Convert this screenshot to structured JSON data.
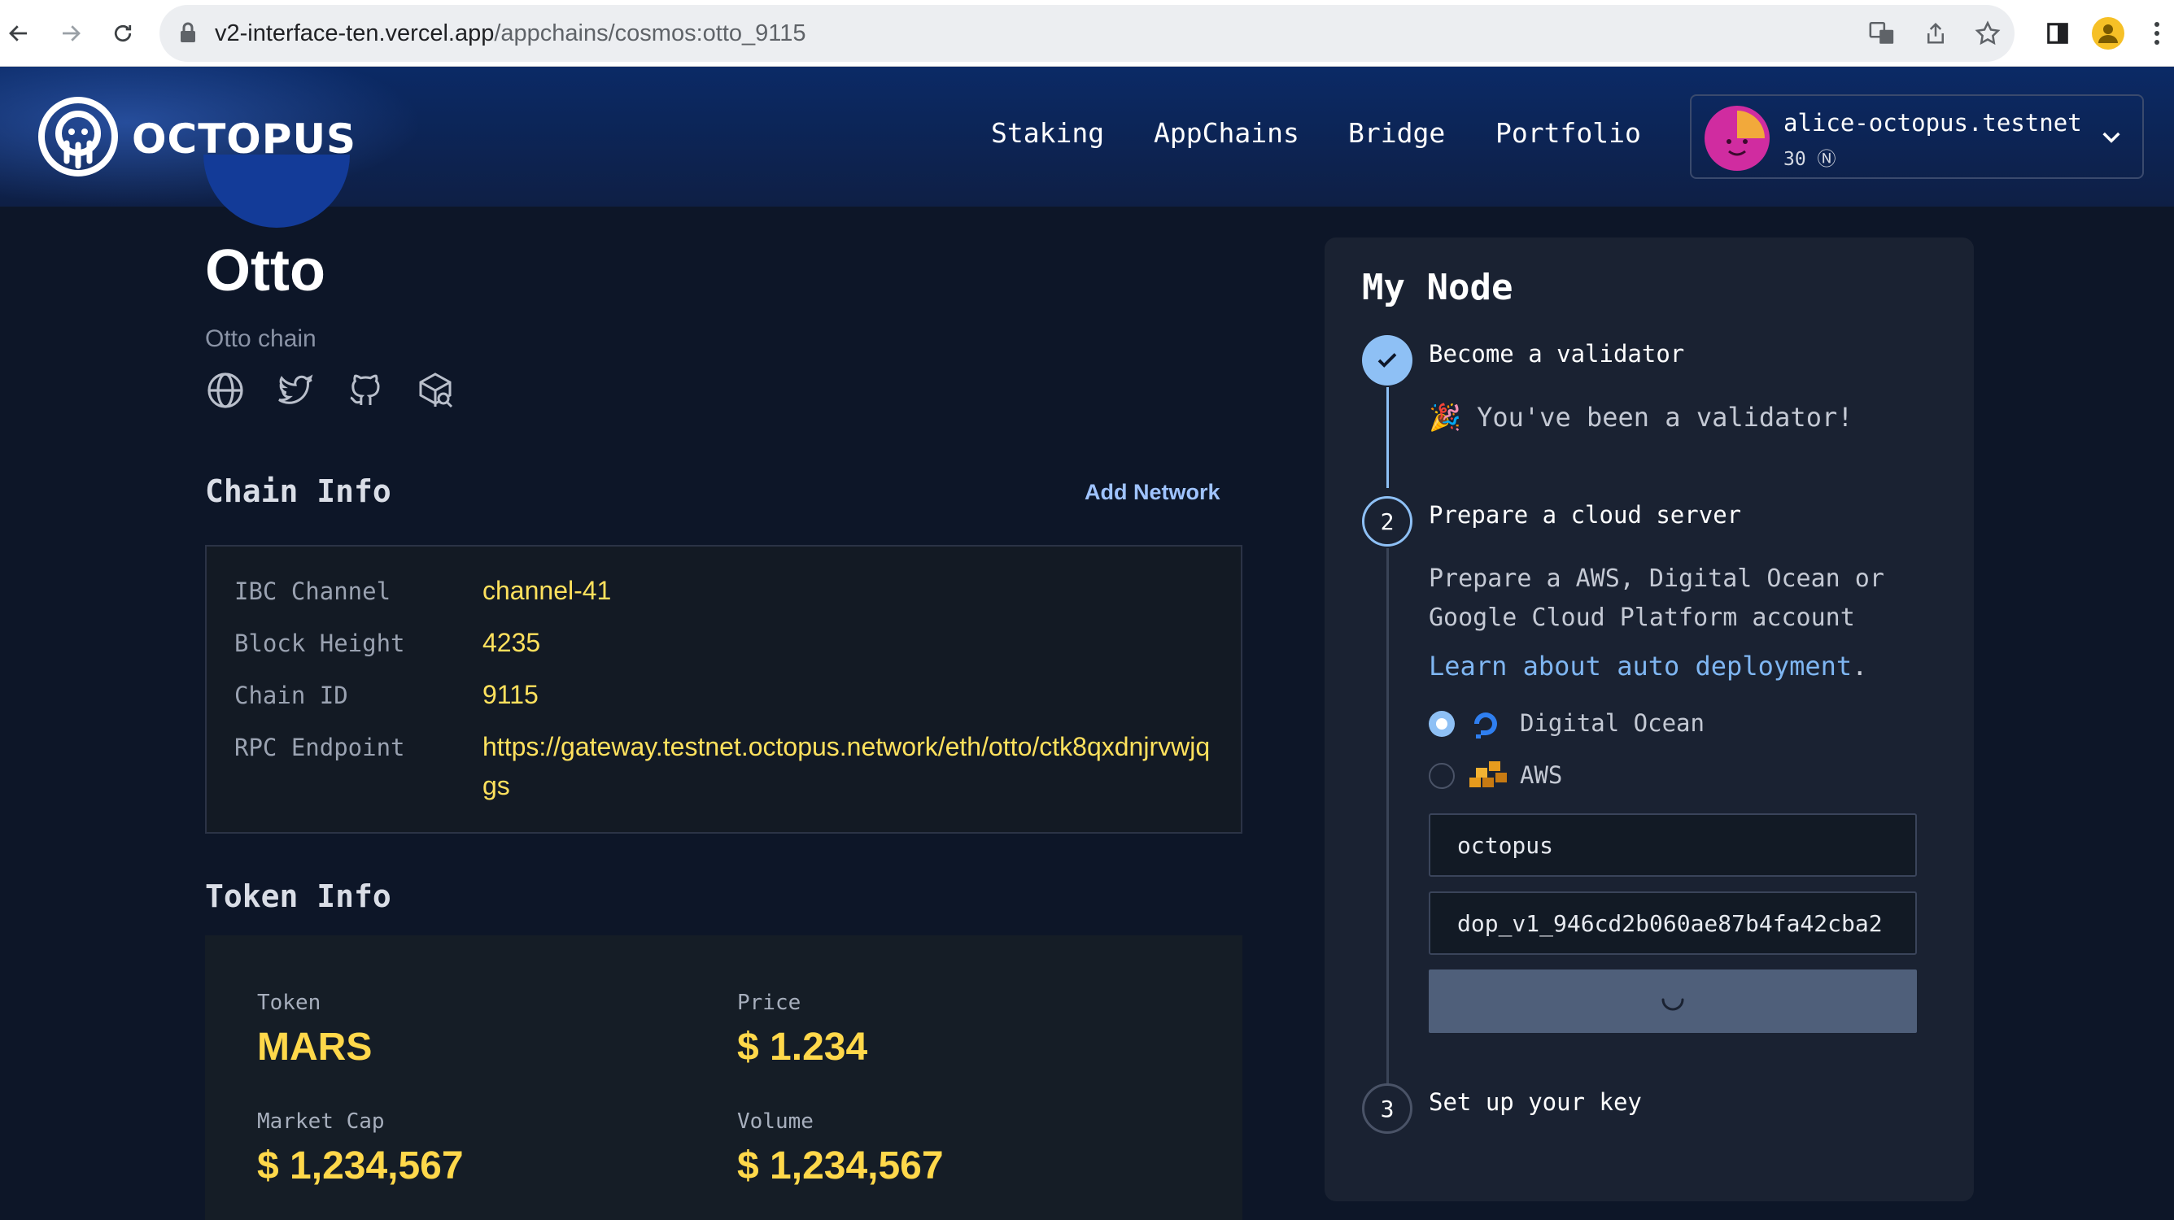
{
  "browser": {
    "url_host": "v2-interface-ten.vercel.app",
    "url_path": "/appchains/cosmos:otto_9115"
  },
  "header": {
    "brand": "OCTOPUS",
    "nav": [
      "Staking",
      "AppChains",
      "Bridge",
      "Portfolio"
    ],
    "account": {
      "name": "alice-octopus.testnet",
      "balance": "30 Ⓝ"
    }
  },
  "chain": {
    "name": "Otto",
    "subtitle": "Otto chain",
    "links": [
      "website-icon",
      "twitter-icon",
      "github-icon",
      "explorer-icon"
    ]
  },
  "chain_info": {
    "title": "Chain Info",
    "add_network": "Add Network",
    "rows": [
      {
        "label": "IBC Channel",
        "value": "channel-41"
      },
      {
        "label": "Block Height",
        "value": "4235"
      },
      {
        "label": "Chain ID",
        "value": "9115"
      },
      {
        "label": "RPC Endpoint",
        "value": "https://gateway.testnet.octopus.network/eth/otto/ctk8qxdnjrvwjqgs"
      }
    ]
  },
  "token_info": {
    "title": "Token Info",
    "token_label": "Token",
    "token_value": "MARS",
    "price_label": "Price",
    "price_value": "$ 1.234",
    "mcap_label": "Market Cap",
    "mcap_value": "$ 1,234,567",
    "volume_label": "Volume",
    "volume_value": "$ 1,234,567"
  },
  "my_node": {
    "title": "My Node",
    "step1": {
      "title": "Become a validator",
      "message": "🎉 You've been a validator!"
    },
    "step2": {
      "number": "2",
      "title": "Prepare a cloud server",
      "description": "Prepare a AWS, Digital Ocean or Google Cloud Platform account",
      "learn_link": "Learn about auto deployment",
      "learn_suffix": ".",
      "providers": [
        {
          "label": "Digital Ocean",
          "selected": true
        },
        {
          "label": "AWS",
          "selected": false
        }
      ],
      "project_value": "octopus",
      "token_value": "dop_v1_946cd2b060ae87b4fa42cba2"
    },
    "step3": {
      "number": "3",
      "title": "Set up your key"
    }
  },
  "colors": {
    "accent": "#ffd84a",
    "link": "#9fc3ff",
    "step_done": "#8ec0f5"
  }
}
